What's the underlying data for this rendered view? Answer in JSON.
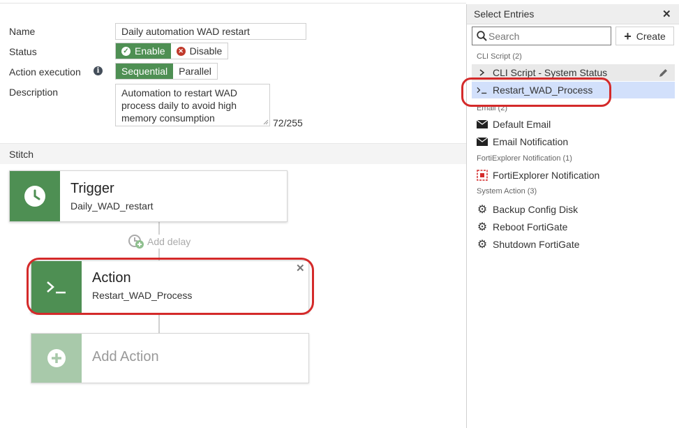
{
  "form": {
    "name_label": "Name",
    "name_value": "Daily automation WAD restart",
    "status_label": "Status",
    "status_enable": "Enable",
    "status_disable": "Disable",
    "action_exec_label": "Action execution",
    "exec_sequential": "Sequential",
    "exec_parallel": "Parallel",
    "description_label": "Description",
    "description_value": "Automation to restart WAD process daily to avoid high memory consumption",
    "char_counter": "72/255"
  },
  "stitch": {
    "section_label": "Stitch",
    "trigger_title": "Trigger",
    "trigger_value": "Daily_WAD_restart",
    "add_delay": "Add delay",
    "action_title": "Action",
    "action_value": "Restart_WAD_Process",
    "add_action": "Add Action"
  },
  "panel": {
    "title": "Select Entries",
    "search_placeholder": "Search",
    "create_label": "Create",
    "groups": [
      {
        "label": "CLI Script (2)",
        "items": [
          "CLI Script - System Status",
          "Restart_WAD_Process"
        ]
      },
      {
        "label": "Email (2)",
        "items": [
          "Default Email",
          "Email Notification"
        ]
      },
      {
        "label": "FortiExplorer Notification (1)",
        "items": [
          "FortiExplorer Notification"
        ]
      },
      {
        "label": "System Action (3)",
        "items": [
          "Backup Config Disk",
          "Reboot FortiGate",
          "Shutdown FortiGate"
        ]
      }
    ]
  },
  "colors": {
    "green": "#4e8f53",
    "green_faded": "#a8c9aa",
    "highlight_red": "#d42a2a",
    "selected_row": "#d2e0fb"
  }
}
